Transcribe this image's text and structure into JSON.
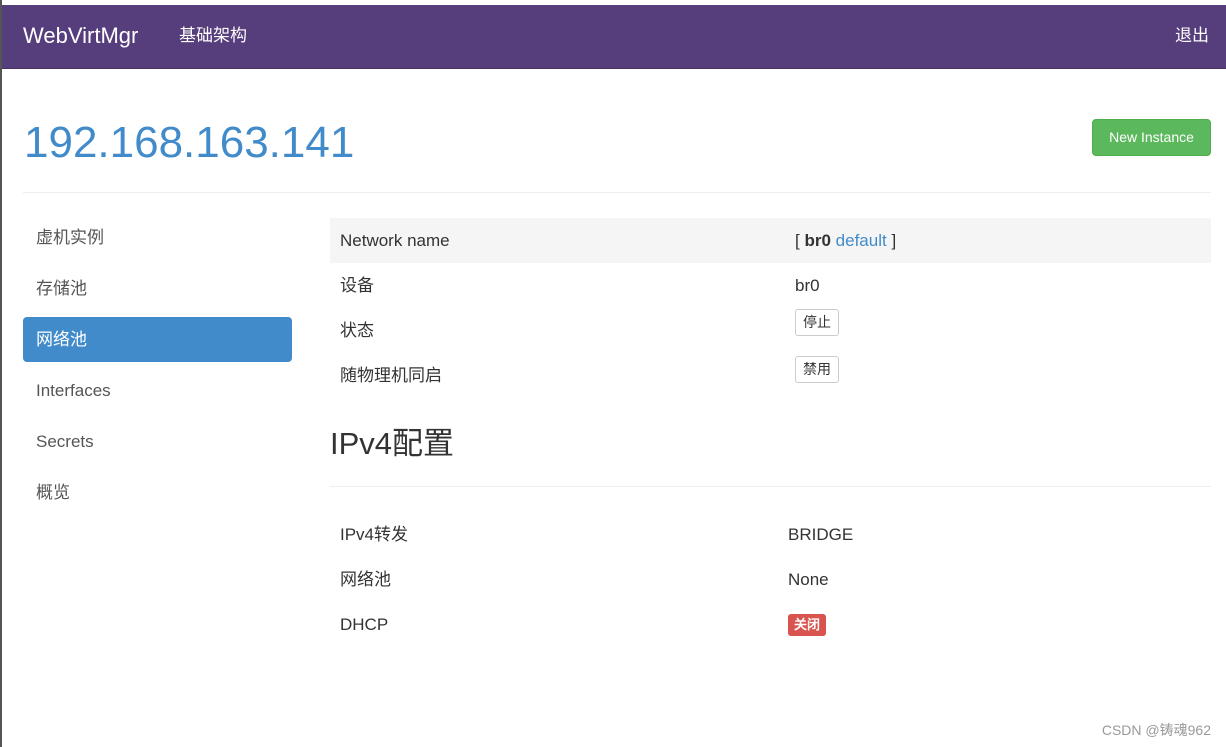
{
  "navbar": {
    "brand": "WebVirtMgr",
    "infrastructure_link": "基础架构",
    "logout_link": "退出"
  },
  "header": {
    "title": "192.168.163.141",
    "new_instance_button": "New Instance"
  },
  "sidebar": {
    "items": [
      {
        "label": "虚机实例",
        "active": false
      },
      {
        "label": "存储池",
        "active": false
      },
      {
        "label": "网络池",
        "active": true
      },
      {
        "label": "Interfaces",
        "active": false
      },
      {
        "label": "Secrets",
        "active": false
      },
      {
        "label": "概览",
        "active": false
      }
    ]
  },
  "network": {
    "rows": {
      "name": {
        "label": "Network name",
        "bracket_open": "[",
        "current": "br0",
        "other_link": "default",
        "bracket_close": "]"
      },
      "device": {
        "label": "设备",
        "value": "br0"
      },
      "state": {
        "label": "状态",
        "button": "停止"
      },
      "autostart": {
        "label": "随物理机同启",
        "button": "禁用"
      }
    }
  },
  "ipv4": {
    "title": "IPv4配置",
    "rows": {
      "forward": {
        "label": "IPv4转发",
        "value": "BRIDGE"
      },
      "pool": {
        "label": "网络池",
        "value": "None"
      },
      "dhcp": {
        "label": "DHCP",
        "badge": "关闭"
      }
    }
  },
  "watermark": "CSDN @铸魂962",
  "colors": {
    "navbar": "#563d7c",
    "accent": "#428bca",
    "success": "#5cb85c",
    "danger": "#d9534f"
  }
}
